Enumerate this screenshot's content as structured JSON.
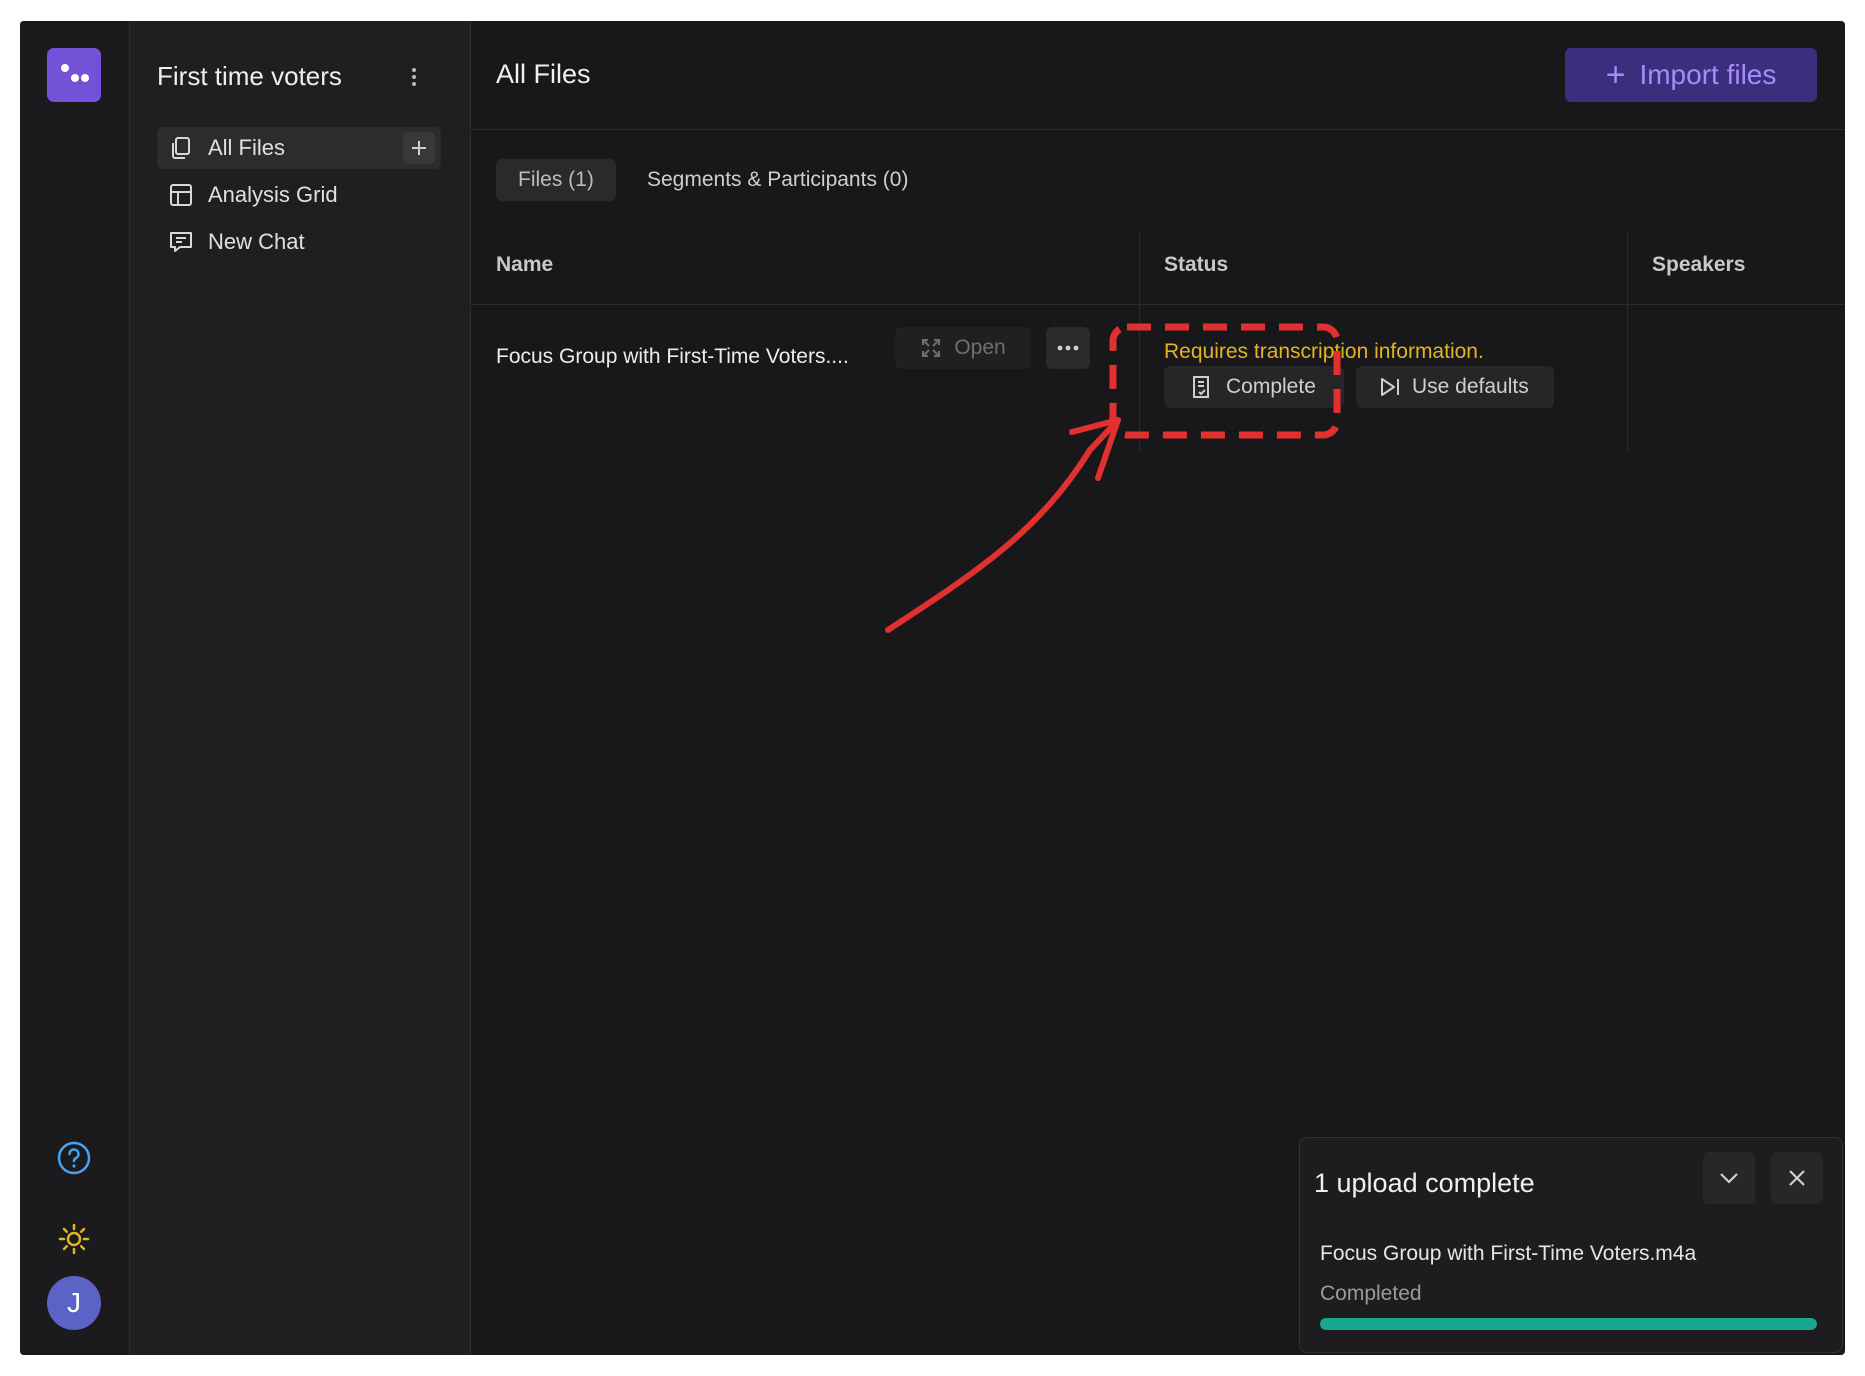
{
  "project": {
    "title": "First time voters"
  },
  "nav": {
    "items": [
      {
        "label": "All Files",
        "icon": "files-icon",
        "active": true
      },
      {
        "label": "Analysis Grid",
        "icon": "grid-icon",
        "active": false
      },
      {
        "label": "New Chat",
        "icon": "chat-icon",
        "active": false
      }
    ]
  },
  "header": {
    "title": "All Files",
    "import_label": "Import files"
  },
  "tabs": [
    {
      "label": "Files (1)",
      "active": true
    },
    {
      "label": "Segments & Participants (0)",
      "active": false
    }
  ],
  "table": {
    "columns": [
      "Name",
      "Status",
      "Speakers"
    ],
    "rows": [
      {
        "name": "Focus Group with First-Time Voters....",
        "open_label": "Open",
        "status": "Requires transcription information.",
        "actions": [
          "Complete",
          "Use defaults"
        ]
      }
    ]
  },
  "toast": {
    "title": "1 upload complete",
    "file_name": "Focus Group with First-Time Voters.m4a",
    "state": "Completed",
    "progress": 1.0
  },
  "user": {
    "initial": "J"
  },
  "colors": {
    "accent": "#7452d8",
    "import_text": "#a78bfa",
    "warning": "#e0b422",
    "progress": "#16a88c",
    "annotation": "#e03030"
  }
}
